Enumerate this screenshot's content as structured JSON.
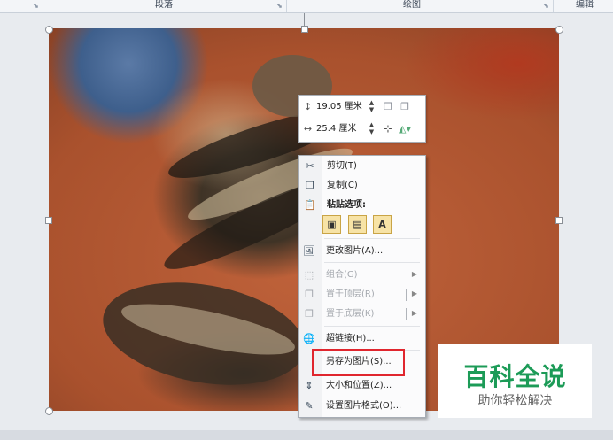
{
  "ribbon": {
    "groups": [
      "段落",
      "绘图",
      "编辑"
    ]
  },
  "mini_toolbar": {
    "height_value": "19.05 厘米",
    "width_value": "25.4 厘米"
  },
  "context_menu": {
    "items": [
      {
        "label": "剪切(T)",
        "icon": "scissors-icon"
      },
      {
        "label": "复制(C)",
        "icon": "copy-icon"
      },
      {
        "label": "粘贴选项:",
        "icon": "paste-icon"
      },
      {
        "label": "更改图片(A)...",
        "icon": "change-picture-icon"
      },
      {
        "label": "组合(G)",
        "icon": "group-icon"
      },
      {
        "label": "置于顶层(R)",
        "icon": "bring-to-front-icon"
      },
      {
        "label": "置于底层(K)",
        "icon": "send-to-back-icon"
      },
      {
        "label": "超链接(H)...",
        "icon": "hyperlink-icon"
      },
      {
        "label": "另存为图片(S)...",
        "icon": ""
      },
      {
        "label": "大小和位置(Z)...",
        "icon": "size-position-icon"
      },
      {
        "label": "设置图片格式(O)...",
        "icon": "format-picture-icon"
      }
    ],
    "paste_options": [
      "picture-paste-icon",
      "picture-format-paste-icon",
      "text-only-paste-icon"
    ],
    "text_only_glyph": "A"
  },
  "watermark": {
    "title": "百科全说",
    "subtitle": "助你轻松解决"
  },
  "colors": {
    "highlight": "#e0262e",
    "watermark_green": "#1c9b57"
  }
}
